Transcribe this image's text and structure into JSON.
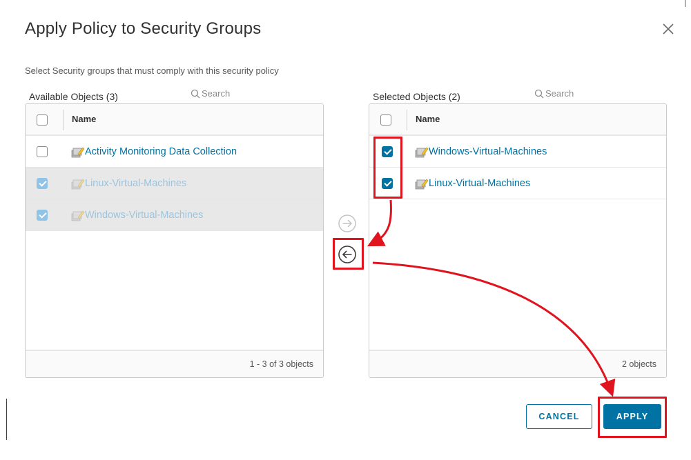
{
  "dialog": {
    "title": "Apply Policy to Security Groups",
    "subtitle": "Select Security groups that must comply with this security policy",
    "close_icon": "close-icon"
  },
  "available": {
    "header": "Available Objects (3)",
    "search_placeholder": "Search",
    "column_name": "Name",
    "rows": [
      {
        "label": "Activity Monitoring Data Collection",
        "checked": false,
        "disabled": false
      },
      {
        "label": "Linux-Virtual-Machines",
        "checked": true,
        "disabled": true
      },
      {
        "label": "Windows-Virtual-Machines",
        "checked": true,
        "disabled": true
      }
    ],
    "footer": "1 - 3 of 3 objects"
  },
  "selected": {
    "header": "Selected Objects (2)",
    "search_placeholder": "Search",
    "column_name": "Name",
    "rows": [
      {
        "label": "Windows-Virtual-Machines",
        "checked": true
      },
      {
        "label": "Linux-Virtual-Machines",
        "checked": true
      }
    ],
    "footer": "2 objects"
  },
  "actions": {
    "cancel_label": "CANCEL",
    "apply_label": "APPLY"
  },
  "colors": {
    "accent": "#0072a3",
    "annotation": "#e0141e"
  }
}
